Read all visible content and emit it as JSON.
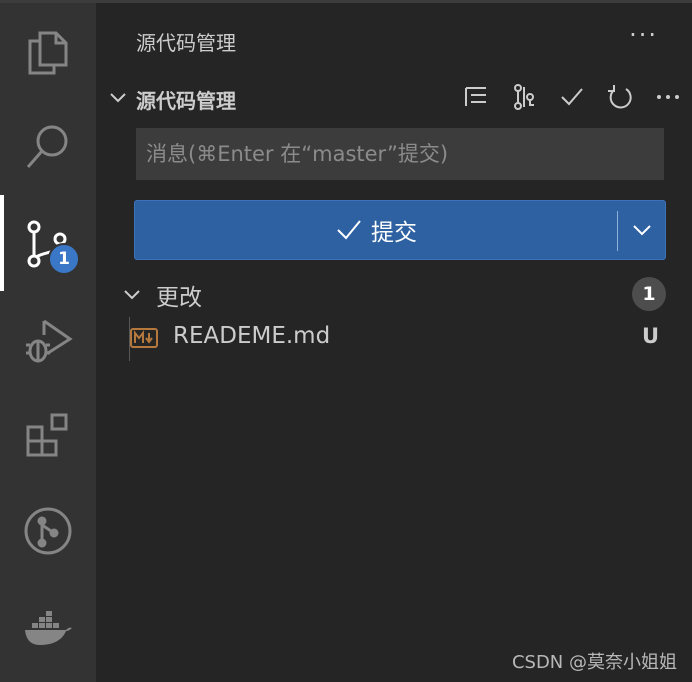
{
  "activity_bar": {
    "items": [
      {
        "name": "explorer",
        "icon": "files-icon"
      },
      {
        "name": "search",
        "icon": "search-icon"
      },
      {
        "name": "source-control",
        "icon": "source-control-icon",
        "badge": "1",
        "active": true
      },
      {
        "name": "run-debug",
        "icon": "debug-icon"
      },
      {
        "name": "extensions",
        "icon": "extensions-icon"
      },
      {
        "name": "git-graph",
        "icon": "git-graph-icon"
      },
      {
        "name": "docker",
        "icon": "docker-icon"
      }
    ]
  },
  "sidebar": {
    "view_title": "源代码管理",
    "more": "···",
    "section": {
      "title": "源代码管理",
      "actions": [
        "tree-view-icon",
        "branch-compare-icon",
        "commit-check-icon",
        "refresh-icon",
        "more-icon"
      ],
      "more": "···"
    },
    "message_input": {
      "placeholder": "消息(⌘Enter 在“master”提交)",
      "value": ""
    },
    "commit_button": {
      "label": "提交"
    },
    "changes": {
      "title": "更改",
      "count": "1",
      "files": [
        {
          "name": "READEME.md",
          "status": "U",
          "icon": "markdown-icon"
        }
      ]
    }
  },
  "watermark": "CSDN @莫奈小姐姐",
  "colors": {
    "activity_bg": "#333333",
    "sidebar_bg": "#252526",
    "input_bg": "#3c3c3c",
    "button_bg": "#2e61a2",
    "badge_bg": "#3a77c6"
  }
}
